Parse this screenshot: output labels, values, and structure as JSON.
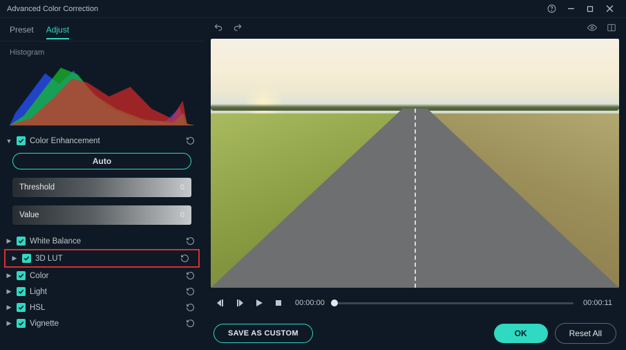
{
  "window": {
    "title": "Advanced Color Correction"
  },
  "tabs": {
    "preset": "Preset",
    "adjust": "Adjust",
    "active": "adjust"
  },
  "histogram": {
    "label": "Histogram"
  },
  "sections": {
    "colorEnhancement": {
      "label": "Color Enhancement",
      "checked": true,
      "expanded": true
    },
    "whiteBalance": {
      "label": "White Balance",
      "checked": true
    },
    "lut3d": {
      "label": "3D LUT",
      "checked": true,
      "highlighted": true
    },
    "color": {
      "label": "Color",
      "checked": true
    },
    "light": {
      "label": "Light",
      "checked": true
    },
    "hsl": {
      "label": "HSL",
      "checked": true
    },
    "vignette": {
      "label": "Vignette",
      "checked": true
    }
  },
  "colorEnhance": {
    "auto": "Auto",
    "threshold": {
      "label": "Threshold",
      "value": "0"
    },
    "value": {
      "label": "Value",
      "value": "0"
    }
  },
  "playback": {
    "current": "00:00:00",
    "total": "00:00:11"
  },
  "footer": {
    "saveCustom": "SAVE AS CUSTOM",
    "ok": "OK",
    "resetAll": "Reset All"
  },
  "colors": {
    "accent": "#2fd9c2",
    "highlight": "#d92f2f"
  }
}
